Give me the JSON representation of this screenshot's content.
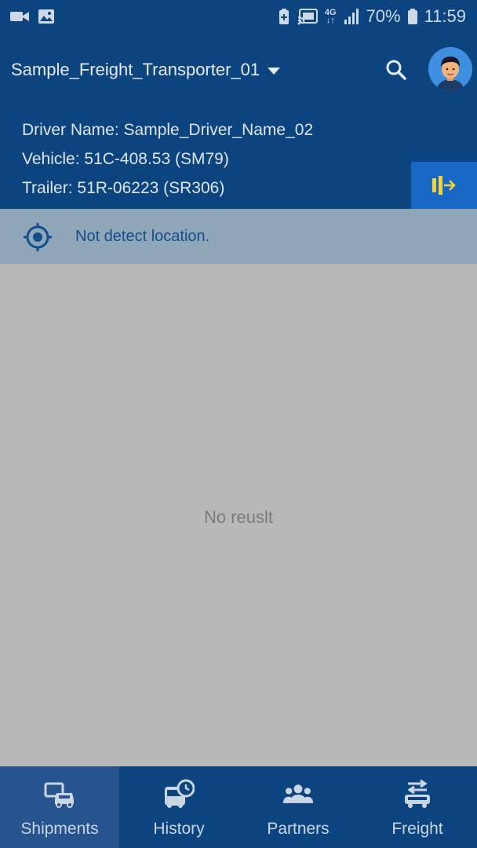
{
  "status_bar": {
    "battery_percent": "70%",
    "time": "11:59",
    "network_type": "4G",
    "icons": [
      "video-icon",
      "image-icon",
      "battery-saver-icon",
      "cast-icon",
      "signal-icon",
      "battery-icon"
    ]
  },
  "header": {
    "transporter": "Sample_Freight_Transporter_01",
    "driver_line": "Driver Name: Sample_Driver_Name_02",
    "vehicle_line": "Vehicle: 51C-408.53 (SM79)",
    "trailer_line": "Trailer: 51R-06223 (SR306)"
  },
  "location": {
    "message": "Not detect location."
  },
  "content": {
    "empty_text": "No reuslt"
  },
  "bottom_nav": {
    "items": [
      {
        "label": "Shipments",
        "icon": "shipments-icon",
        "active": true
      },
      {
        "label": "History",
        "icon": "history-icon",
        "active": false
      },
      {
        "label": "Partners",
        "icon": "partners-icon",
        "active": false
      },
      {
        "label": "Freight",
        "icon": "freight-icon",
        "active": false
      }
    ]
  },
  "colors": {
    "primary": "#0c4480",
    "accent_button": "#1668c4",
    "handover_icon": "#f5d33a",
    "location_bar": "#8ea6b7",
    "overlay_gray": "#b8b8b8"
  }
}
